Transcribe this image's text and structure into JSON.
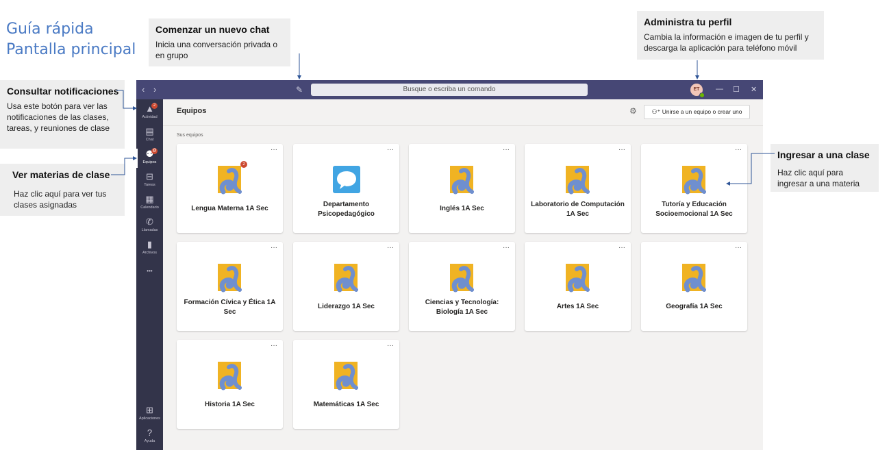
{
  "guide": {
    "title_line1": "Guía rápida",
    "title_line2": "Pantalla principal"
  },
  "callouts": {
    "new_chat": {
      "heading": "Comenzar un nuevo chat",
      "body": "Inicia una conversación privada o en grupo"
    },
    "profile": {
      "heading": "Administra tu perfil",
      "body": "Cambia la información e imagen de tu perfil y descarga la aplicación para teléfono móvil"
    },
    "notifications": {
      "heading": "Consultar notificaciones",
      "body": "Usa este botón para ver las notificaciones de las clases, tareas, y reuniones de clase"
    },
    "subjects": {
      "heading": "Ver materias de clase",
      "body": "Haz clic aquí para ver tus clases asignadas"
    },
    "enter_class": {
      "heading": "Ingresar a una clase",
      "body": "Haz clic aquí para ingresar a una materia"
    }
  },
  "app": {
    "search_placeholder": "Busque o escriba un comando",
    "avatar_initials": "ET",
    "header_title": "Equipos",
    "join_button": "Unirse a un equipo o crear uno",
    "section_label": "Sus equipos",
    "rail": [
      {
        "label": "Actividad",
        "icon": "bell-icon",
        "badge": "2"
      },
      {
        "label": "Chat",
        "icon": "chat-icon",
        "badge": ""
      },
      {
        "label": "Equipos",
        "icon": "teams-icon",
        "badge": "@"
      },
      {
        "label": "Tareas",
        "icon": "assignments-icon",
        "badge": ""
      },
      {
        "label": "Calendario",
        "icon": "calendar-icon",
        "badge": ""
      },
      {
        "label": "Llamadas",
        "icon": "phone-icon",
        "badge": ""
      },
      {
        "label": "Archivos",
        "icon": "files-icon",
        "badge": ""
      }
    ],
    "rail_more": "•••",
    "rail_bottom": [
      {
        "label": "Aplicaciones",
        "icon": "apps-icon"
      },
      {
        "label": "Ayuda",
        "icon": "help-icon"
      }
    ],
    "teams": [
      {
        "name": "Lengua Materna 1A Sec",
        "badge": "2",
        "logo": "school-logo"
      },
      {
        "name": "Departamento Psicopedagógico",
        "badge": "",
        "logo": "chat-bubble"
      },
      {
        "name": "Inglés 1A Sec",
        "badge": "",
        "logo": "school-logo"
      },
      {
        "name": "Laboratorio de Computación 1A Sec",
        "badge": "",
        "logo": "school-logo"
      },
      {
        "name": "Tutoría y Educación Socioemocional 1A Sec",
        "badge": "",
        "logo": "school-logo"
      },
      {
        "name": "Formación Cívica y Ética 1A Sec",
        "badge": "",
        "logo": "school-logo"
      },
      {
        "name": "Liderazgo 1A Sec",
        "badge": "",
        "logo": "school-logo"
      },
      {
        "name": "Ciencias y Tecnología: Biología 1A Sec",
        "badge": "",
        "logo": "school-logo"
      },
      {
        "name": "Artes 1A Sec",
        "badge": "",
        "logo": "school-logo"
      },
      {
        "name": "Geografía 1A Sec",
        "badge": "",
        "logo": "school-logo"
      },
      {
        "name": "Historia 1A Sec",
        "badge": "",
        "logo": "school-logo"
      },
      {
        "name": "Matemáticas 1A Sec",
        "badge": "",
        "logo": "school-logo"
      }
    ],
    "more_glyph": "···"
  },
  "colors": {
    "titlebar": "#464775",
    "rail": "#33344a",
    "accent_title": "#4a7ac4",
    "logo_yellow": "#f0b323",
    "logo_blue": "#6f8fcf",
    "badge": "#cc4a31"
  }
}
